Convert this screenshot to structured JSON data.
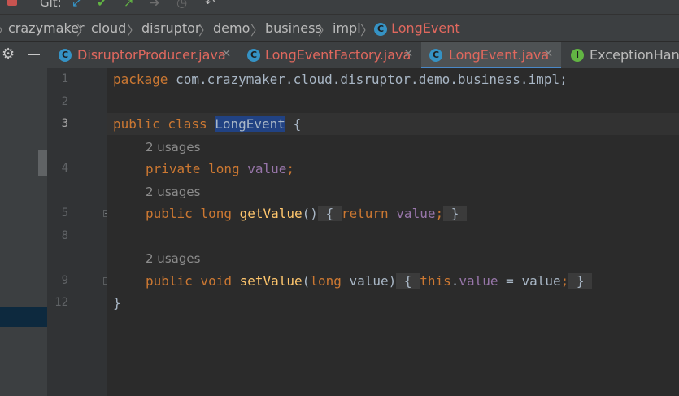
{
  "toolbar": {
    "git_label": "Git:",
    "icons": [
      "stop-icon",
      "update-project-icon",
      "commit-icon",
      "push-icon",
      "history-icon",
      "revert-icon"
    ]
  },
  "breadcrumb": {
    "items": [
      "crazymaker",
      "cloud",
      "disruptor",
      "demo",
      "business",
      "impl"
    ],
    "current": "LongEvent",
    "class_badge": "C"
  },
  "tabs": [
    {
      "label": "DisruptorProducer.java",
      "badge": "C",
      "color": "#e0685e"
    },
    {
      "label": "LongEventFactory.java",
      "badge": "C",
      "color": "#e0685e"
    },
    {
      "label": "LongEvent.java",
      "badge": "C",
      "color": "#e0685e",
      "selected": true
    },
    {
      "label": "ExceptionHand",
      "badge": "I",
      "color": "#bbbbbb"
    }
  ],
  "close_glyph": "×",
  "editor": {
    "line_numbers": [
      "1",
      "2",
      "3",
      "4",
      "5",
      "8",
      "9",
      "12"
    ],
    "hints": [
      "2 usages",
      "2 usages",
      "2 usages"
    ],
    "code": {
      "l1_kw": "package",
      "l1_rest": " com.crazymaker.cloud.disruptor.demo.business.impl;",
      "l3_kw": "public class",
      "l3_name": "LongEvent",
      "l3_rest": " {",
      "l4_kw": "private long",
      "l4_field": "value",
      "l4_rest": ";",
      "l5_kw": "public long",
      "l5_fn": "getValue",
      "l5_paren": "()",
      "l5_open": "{",
      "l5_kw2": "return",
      "l5_field": "value",
      "l5_semi": ";",
      "l5_close": "}",
      "l9_kw": "public void",
      "l9_fn": "setValue",
      "l9_paren_open": "(",
      "l9_kw2": "long",
      "l9_param": " value)",
      "l9_open": "{",
      "l9_this": "this",
      "l9_dot": ".",
      "l9_field": "value",
      "l9_assign": " = value",
      "l9_semi": ";",
      "l9_close": "}",
      "l12": "}"
    }
  },
  "colors": {
    "keyword": "#cc7832",
    "field": "#9876aa",
    "method": "#ffc66d",
    "text": "#a9b7c6",
    "modified_file": "#e0685e"
  }
}
